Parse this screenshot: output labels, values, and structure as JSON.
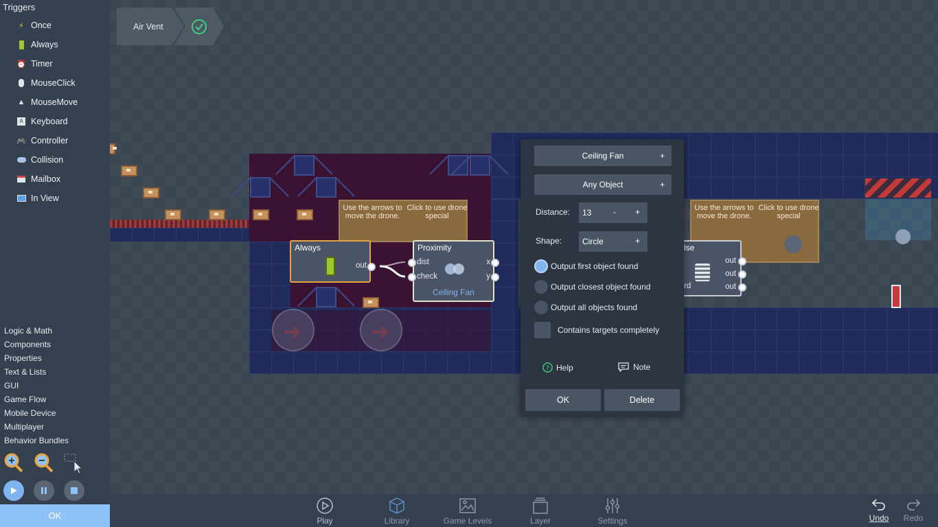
{
  "sidebar": {
    "header": "Triggers",
    "triggers": [
      {
        "label": "Once",
        "icon": "lightning-icon"
      },
      {
        "label": "Always",
        "icon": "battery-icon"
      },
      {
        "label": "Timer",
        "icon": "alarm-clock-icon"
      },
      {
        "label": "MouseClick",
        "icon": "mouse-icon"
      },
      {
        "label": "MouseMove",
        "icon": "cursor-icon"
      },
      {
        "label": "Keyboard",
        "icon": "key-icon"
      },
      {
        "label": "Controller",
        "icon": "gamepad-icon"
      },
      {
        "label": "Collision",
        "icon": "collision-icon"
      },
      {
        "label": "Mailbox",
        "icon": "mailbox-icon"
      },
      {
        "label": "In View",
        "icon": "monitor-icon"
      }
    ],
    "categories": [
      "Logic & Math",
      "Components",
      "Properties",
      "Text & Lists",
      "GUI",
      "Game Flow",
      "Mobile Device",
      "Multiplayer",
      "Behavior Bundles"
    ],
    "ok_label": "OK"
  },
  "breadcrumb": {
    "item": "Air Vent"
  },
  "level": {
    "hint_left_1": "Use the arrows to move the drone.",
    "hint_left_2": "Click to use drone special",
    "hint_right_1": "Use the arrows to move the drone.",
    "hint_right_2": "Click to use drone special"
  },
  "nodes": {
    "always": {
      "title": "Always",
      "out": "out"
    },
    "proximity": {
      "title": "Proximity",
      "dist": "dist",
      "check": "check",
      "x": "x",
      "y": "y",
      "target": "Ceiling Fan"
    },
    "else": {
      "title": "lse",
      "port_bottom": "rd",
      "out1": "out",
      "out2": "out",
      "out3": "out"
    }
  },
  "dialog": {
    "object_select": "Ceiling Fan",
    "filter_select": "Any Object",
    "plus": "+",
    "distance_label": "Distance:",
    "distance_value": "13",
    "minus": "-",
    "shape_label": "Shape:",
    "shape_value": "Circle",
    "radio_first": "Output first object found",
    "radio_closest": "Output closest object found",
    "radio_all": "Output all objects found",
    "checkbox_contains": "Contains targets completely",
    "help": "Help",
    "note": "Note",
    "ok": "OK",
    "delete": "Delete"
  },
  "bottombar": {
    "play": "Play",
    "library": "Library",
    "levels": "Game Levels",
    "layer": "Layer",
    "settings": "Settings",
    "undo": "Undo",
    "redo": "Redo"
  },
  "colors": {
    "accent": "#7fb4ee",
    "sidebar": "#34404d",
    "canvas": "#3b4653",
    "node_orange": "#e8a341",
    "node_blue_border": "#dfe6c8"
  }
}
